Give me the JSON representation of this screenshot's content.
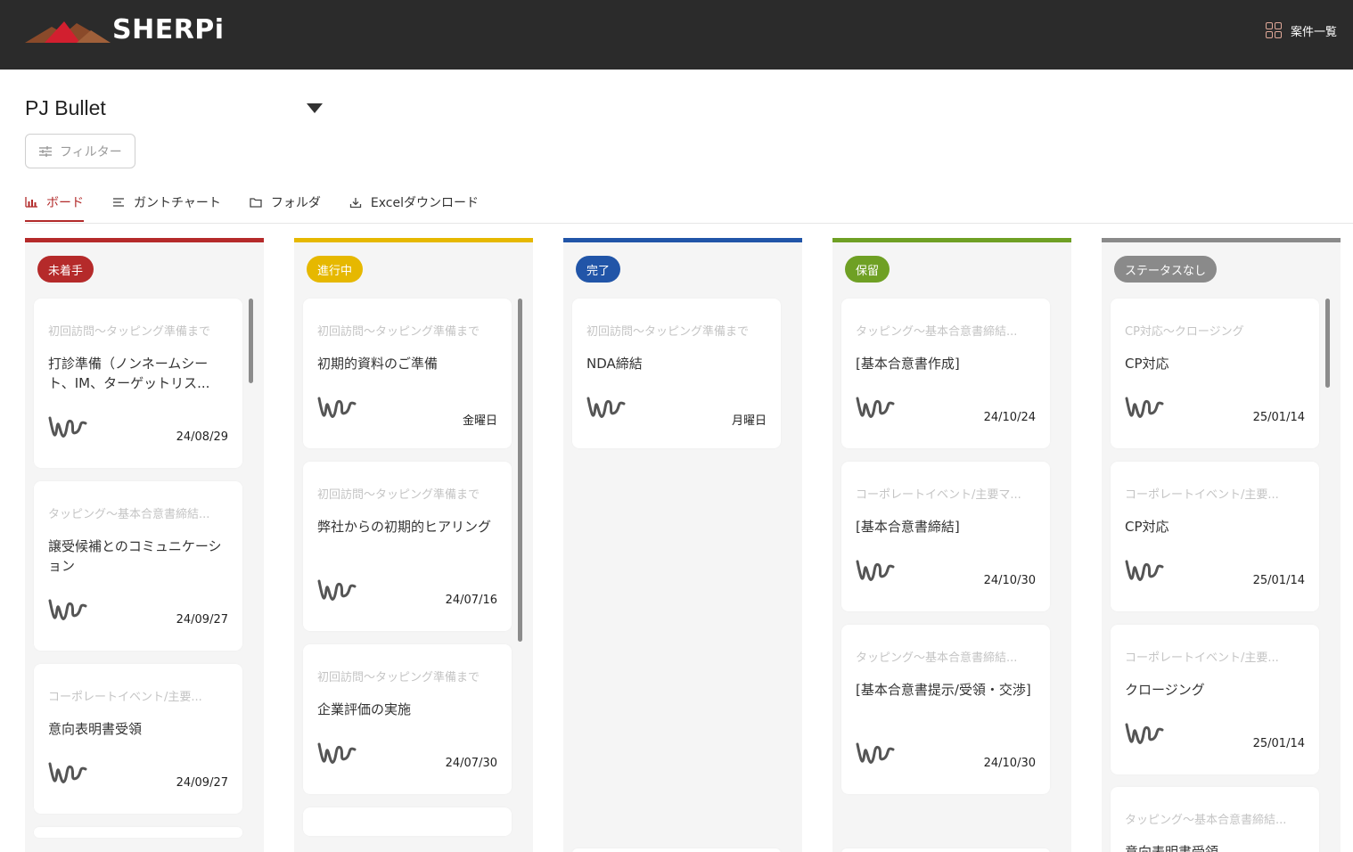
{
  "header": {
    "logo_text": "SHERPi",
    "nav_label": "案件一覧",
    "nav_icon": "grid-icon"
  },
  "project": {
    "name": "PJ Bullet",
    "filter_label": "フィルター"
  },
  "tabs": [
    {
      "label": "ボード",
      "icon": "bar-chart-icon",
      "active": true
    },
    {
      "label": "ガントチャート",
      "icon": "gantt-icon",
      "active": false
    },
    {
      "label": "フォルダ",
      "icon": "folder-icon",
      "active": false
    },
    {
      "label": "Excelダウンロード",
      "icon": "download-icon",
      "active": false
    }
  ],
  "columns": [
    {
      "status": "未着手",
      "color": "#b52a2a",
      "cards": [
        {
          "phase": "初回訪問〜タッピング準備まで",
          "title": "打診準備（ノンネームシート、IM、ターゲットリス...",
          "date": "24/08/29"
        },
        {
          "phase": "タッピング〜基本合意書締結...",
          "title": "譲受候補とのコミュニケーション",
          "date": "24/09/27"
        },
        {
          "phase": "コーポレートイベント/主要...",
          "title": "意向表明書受領",
          "date": "24/09/27"
        }
      ]
    },
    {
      "status": "進行中",
      "color": "#e6b800",
      "cards": [
        {
          "phase": "初回訪問〜タッピング準備まで",
          "title": "初期的資料のご準備",
          "date": "金曜日"
        },
        {
          "phase": "初回訪問〜タッピング準備まで",
          "title": "弊社からの初期的ヒアリング",
          "date": "24/07/16"
        },
        {
          "phase": "初回訪問〜タッピング準備まで",
          "title": "企業評価の実施",
          "date": "24/07/30"
        }
      ]
    },
    {
      "status": "完了",
      "color": "#2155a8",
      "cards": [
        {
          "phase": "初回訪問〜タッピング準備まで",
          "title": "NDA締結",
          "date": "月曜日"
        }
      ]
    },
    {
      "status": "保留",
      "color": "#6fa024",
      "cards": [
        {
          "phase": "タッピング〜基本合意書締結...",
          "title": "[基本合意書作成]",
          "date": "24/10/24"
        },
        {
          "phase": "コーポレートイベント/主要マ...",
          "title": "[基本合意書締結]",
          "date": "24/10/30"
        },
        {
          "phase": "タッピング〜基本合意書締結...",
          "title": "[基本合意書提示/受領・交渉]",
          "date": "24/10/30"
        }
      ]
    },
    {
      "status": "ステータスなし",
      "color": "#8a8a8a",
      "cards": [
        {
          "phase": "CP対応〜クロージング",
          "title": "CP対応",
          "date": "25/01/14"
        },
        {
          "phase": "コーポレートイベント/主要...",
          "title": "CP対応",
          "date": "25/01/14"
        },
        {
          "phase": "コーポレートイベント/主要...",
          "title": "クロージング",
          "date": "25/01/14"
        },
        {
          "phase": "タッピング〜基本合意書締結...",
          "title": "意向表明書受領",
          "date": ""
        }
      ]
    }
  ]
}
